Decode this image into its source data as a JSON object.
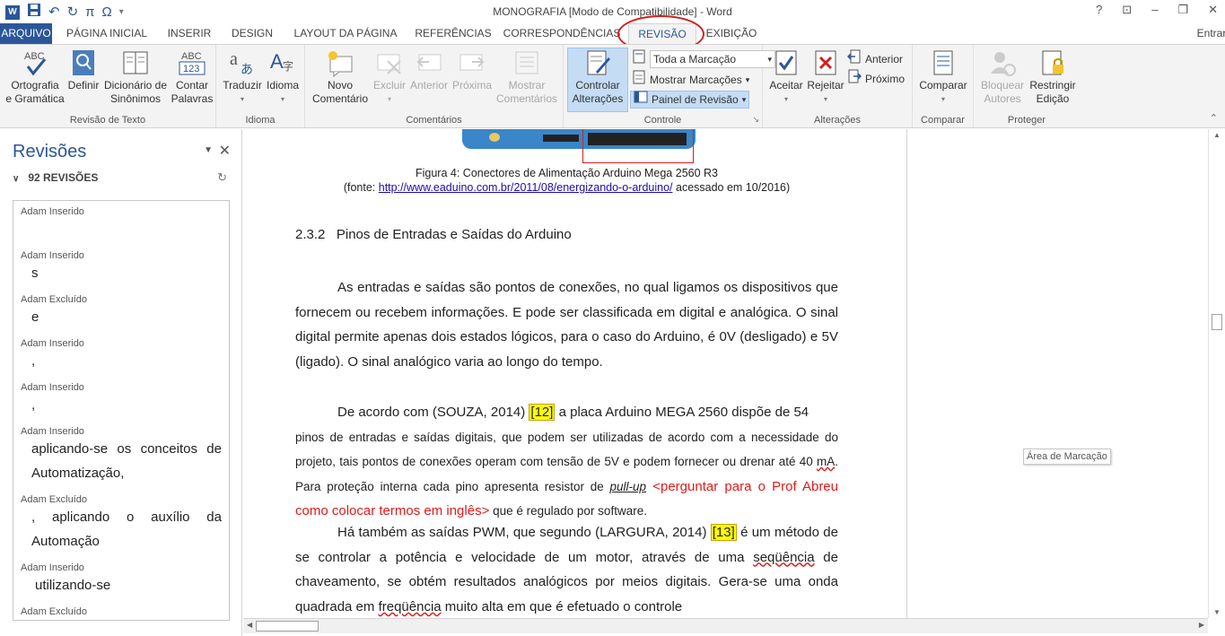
{
  "window": {
    "title": "MONOGRAFIA [Modo de Compatibilidade] - Word",
    "user": "Entrar"
  },
  "qat": {
    "save": "save-icon",
    "undo": "↶",
    "redo": "↻",
    "pi": "π",
    "omega": "Ω"
  },
  "tabs": [
    "ARQUIVO",
    "PÁGINA INICIAL",
    "INSERIR",
    "DESIGN",
    "LAYOUT DA PÁGINA",
    "REFERÊNCIAS",
    "CORRESPONDÊNCIAS",
    "REVISÃO",
    "EXIBIÇÃO"
  ],
  "ribbon": {
    "revisao_texto": {
      "label": "Revisão de Texto",
      "ortografia": "Ortografia\ne Gramática",
      "definir": "Definir",
      "dicionario": "Dicionário de\nSinônimos",
      "contar": "Contar\nPalavras"
    },
    "idioma": {
      "label": "Idioma",
      "traduzir": "Traduzir",
      "idioma_btn": "Idioma"
    },
    "comentarios": {
      "label": "Comentários",
      "novo": "Novo\nComentário",
      "excluir": "Excluir",
      "anterior": "Anterior",
      "proxima": "Próxima",
      "mostrar": "Mostrar\nComentários"
    },
    "controle": {
      "label": "Controle",
      "controlar": "Controlar\nAlterações",
      "marcacao": "Toda a Marcação",
      "mostrar_marcacoes": "Mostrar Marcações",
      "painel": "Painel de Revisão"
    },
    "alteracoes": {
      "label": "Alterações",
      "aceitar": "Aceitar",
      "rejeitar": "Rejeitar",
      "anterior": "Anterior",
      "proximo": "Próximo"
    },
    "comparar": {
      "label": "Comparar",
      "comparar": "Comparar"
    },
    "proteger": {
      "label": "Proteger",
      "bloquear": "Bloquear\nAutores",
      "restringir": "Restringir\nEdição"
    }
  },
  "pane": {
    "title": "Revisões",
    "count": "92 REVISÕES",
    "items": [
      {
        "who": "Adam Inserido",
        "what": ""
      },
      {
        "who": "Adam Inserido",
        "what": "s"
      },
      {
        "who": "Adam Excluído",
        "what": "e"
      },
      {
        "who": "Adam Inserido",
        "what": ","
      },
      {
        "who": "Adam Inserido",
        "what": ","
      },
      {
        "who": "Adam Inserido",
        "what": "aplicando-se os conceitos de Automatização,"
      },
      {
        "who": "Adam Excluído",
        "what": ", aplicando o auxílio da Automação"
      },
      {
        "who": "Adam Inserido",
        "what": "utilizando-se"
      },
      {
        "who": "Adam Excluído",
        "what": ""
      }
    ]
  },
  "doc": {
    "caption1": "Figura 4: Conectores de Alimentação Arduino Mega 2560 R3",
    "caption2_pre": "(fonte: ",
    "caption2_link": "http://www.eaduino.com.br/2011/08/energizando-o-arduino/",
    "caption2_post": " acessado em 10/2016)",
    "heading": "2.3.2   Pinos de Entradas e Saídas do Arduino",
    "p1": "As entradas e saídas são pontos de conexões, no qual ligamos os dispositivos que fornecem ou recebem informações. E pode ser classificada em digital e analógica. O sinal digital permite apenas dois estados lógicos, para o caso do Arduino, é 0V (desligado) e 5V (ligado). O sinal analógico varia ao longo do tempo.",
    "p2_a": "De acordo com (SOUZA, 2014) ",
    "p2_ref": "[12]",
    "p2_b": " a placa Arduino MEGA 2560 dispõe de 54",
    "p2_c": "pinos de entradas e saídas digitais, que podem ser utilizadas de acordo com a necessidade do projeto, tais pontos de conexões operam com tensão de 5V e podem fornecer ou drenar até 40 ",
    "p2_ma": "mA",
    "p2_d": ". Para proteção interna cada pino apresenta resistor de ",
    "p2_pullup": "pull-up",
    "p2_comment": " <perguntar para o Prof Abreu como colocar termos em inglês>",
    "p2_e": " que é regulado por software.",
    "p3_a": "Há também as saídas PWM, que segundo (LARGURA, 2014) ",
    "p3_ref": "[13]",
    "p3_b": " é um método de se controlar a potência e velocidade de um motor, através de uma ",
    "p3_seq": "seqüência",
    "p3_c": " de chaveamento, se obtém resultados analógicos por meios digitais. Gera-se uma onda quadrada em ",
    "p3_freq": "freqüência",
    "p3_d": " muito alta em que é efetuado o controle"
  },
  "markup_tip": "Área de Marcação"
}
